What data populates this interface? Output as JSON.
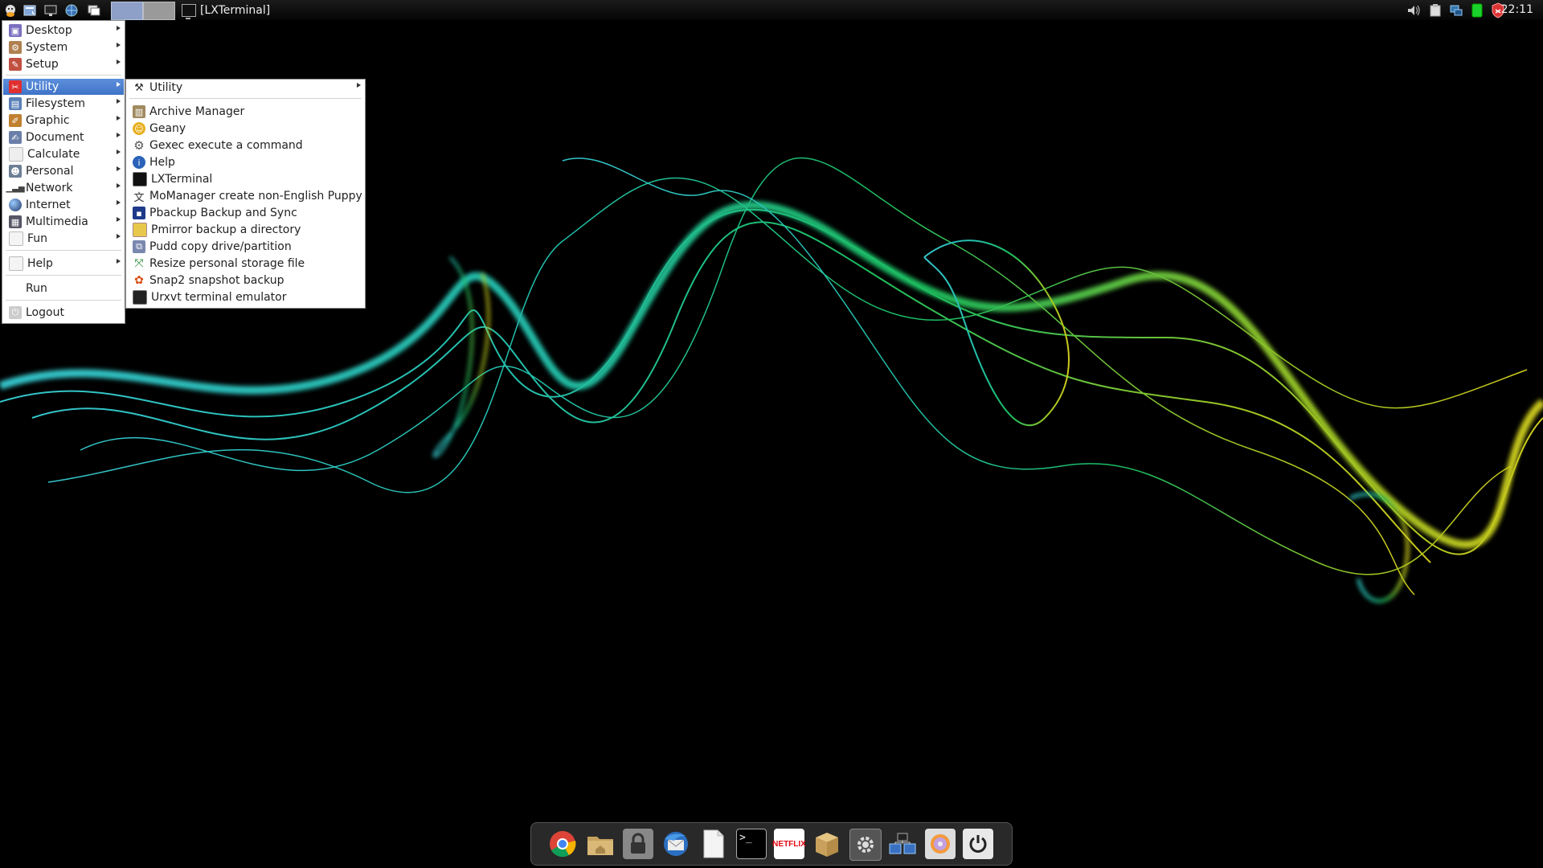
{
  "taskbar": {
    "active_task": "[LXTerminal]",
    "clock": "22:11"
  },
  "main_menu": {
    "items": [
      {
        "label": "Desktop",
        "icon": "desktop-icon",
        "submenu": true
      },
      {
        "label": "System",
        "icon": "system-icon",
        "submenu": true
      },
      {
        "label": "Setup",
        "icon": "setup-icon",
        "submenu": true
      },
      {
        "label": "Utility",
        "icon": "utility-icon",
        "submenu": true,
        "active": true
      },
      {
        "label": "Filesystem",
        "icon": "filesystem-icon",
        "submenu": true
      },
      {
        "label": "Graphic",
        "icon": "graphic-icon",
        "submenu": true
      },
      {
        "label": "Document",
        "icon": "document-icon",
        "submenu": true
      },
      {
        "label": "Calculate",
        "icon": "calculate-icon",
        "submenu": true
      },
      {
        "label": "Personal",
        "icon": "personal-icon",
        "submenu": true
      },
      {
        "label": "Network",
        "icon": "network-icon",
        "submenu": true
      },
      {
        "label": "Internet",
        "icon": "internet-icon",
        "submenu": true
      },
      {
        "label": "Multimedia",
        "icon": "multimedia-icon",
        "submenu": true
      },
      {
        "label": "Fun",
        "icon": "fun-icon",
        "submenu": true
      },
      {
        "label": "Help",
        "icon": "help-icon",
        "submenu": true
      },
      {
        "label": "Run",
        "icon": "",
        "submenu": false
      },
      {
        "label": "Logout",
        "icon": "logout-icon",
        "submenu": false
      }
    ]
  },
  "utility_menu": {
    "header": "Utility",
    "items": [
      {
        "label": "Archive Manager",
        "icon": "archive-icon"
      },
      {
        "label": "Geany",
        "icon": "geany-icon"
      },
      {
        "label": "Gexec execute a command",
        "icon": "gear-icon"
      },
      {
        "label": "Help",
        "icon": "info-icon"
      },
      {
        "label": "LXTerminal",
        "icon": "terminal-icon"
      },
      {
        "label": "MoManager create non-English Puppy",
        "icon": "translate-icon"
      },
      {
        "label": "Pbackup Backup and Sync",
        "icon": "floppy-icon"
      },
      {
        "label": "Pmirror backup a directory",
        "icon": "folder-icon"
      },
      {
        "label": "Pudd copy drive/partition",
        "icon": "drive-copy-icon"
      },
      {
        "label": "Resize personal storage file",
        "icon": "resize-icon"
      },
      {
        "label": "Snap2 snapshot backup",
        "icon": "snapshot-icon"
      },
      {
        "label": "Urxvt terminal emulator",
        "icon": "terminal-icon"
      }
    ]
  },
  "dock": {
    "items": [
      "chrome-icon",
      "home-folder-icon",
      "lock-icon",
      "thunderbird-icon",
      "text-file-icon",
      "terminal-icon",
      "netflix-icon",
      "package-icon",
      "settings-icon",
      "network-manager-icon",
      "disc-burner-icon",
      "power-icon"
    ],
    "netflix_label": "NETFLIX",
    "terminal_glyph": ">_"
  },
  "colors": {
    "menu_highlight": "#4a7fd4",
    "panel_bg": "#0d0d0d"
  }
}
